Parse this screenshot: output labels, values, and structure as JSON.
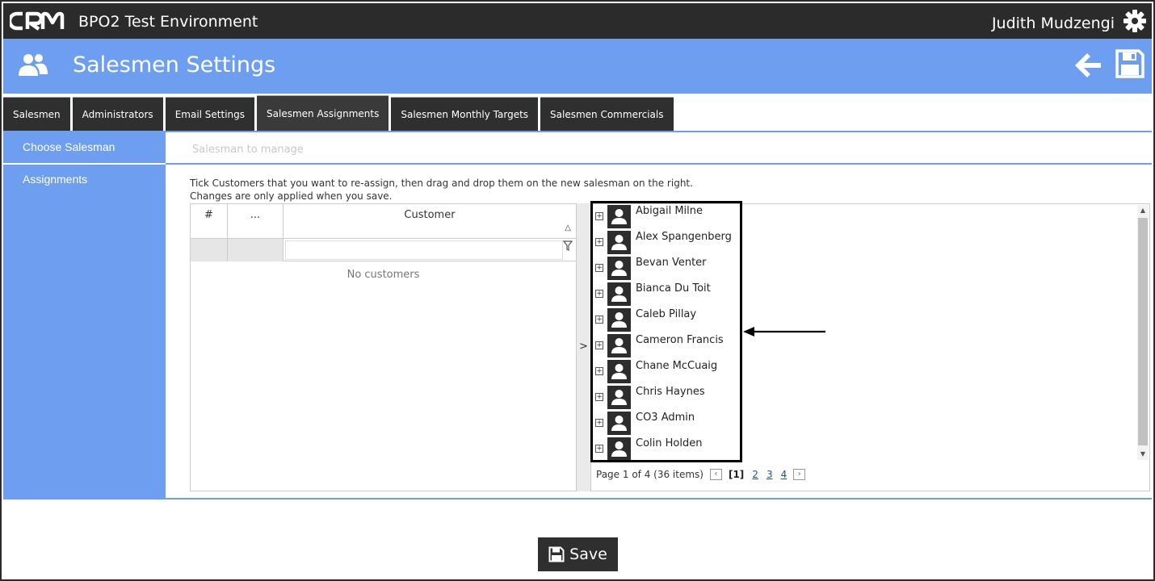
{
  "app": {
    "logo_text": "CRM",
    "title": "BPO2 Test Environment",
    "user": "Judith Mudzengi"
  },
  "header": {
    "title": "Salesmen Settings"
  },
  "tabs": [
    {
      "label": "Salesmen"
    },
    {
      "label": "Administrators"
    },
    {
      "label": "Email Settings"
    },
    {
      "label": "Salesmen Assignments",
      "active": true
    },
    {
      "label": "Salesmen Monthly Targets"
    },
    {
      "label": "Salesmen Commercials"
    }
  ],
  "sidebar": {
    "choose": "Choose Salesman",
    "assignments": "Assignments"
  },
  "salesman_select": {
    "placeholder": "Salesman to manage"
  },
  "instructions": {
    "line1": "Tick Customers that you want to re-assign, then drag and drop them on the new salesman on the right.",
    "line2": "Changes are only applied when you save."
  },
  "customer_grid": {
    "col_num": "#",
    "col_more": "...",
    "col_customer": "Customer",
    "empty": "No customers"
  },
  "splitter": {
    "glyph": ">"
  },
  "salesmen": [
    "Abigail Milne",
    "Alex Spangenberg",
    "Bevan Venter",
    "Bianca Du Toit",
    "Caleb Pillay",
    "Cameron Francis",
    "Chane McCuaig",
    "Chris Haynes",
    "CO3 Admin",
    "Colin Holden"
  ],
  "pager": {
    "info": "Page 1 of 4 (36 items)",
    "current": "[1]",
    "pages": [
      "2",
      "3",
      "4"
    ]
  },
  "save_button": {
    "label": "Save"
  },
  "colors": {
    "dark": "#2b2b2b",
    "accent_blue": "#6e9ef0"
  }
}
